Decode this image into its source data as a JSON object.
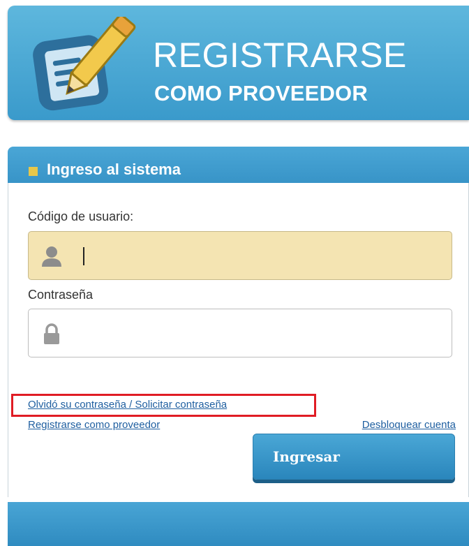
{
  "banner": {
    "title": "REGISTRARSE",
    "subtitle": "COMO PROVEEDOR",
    "icon": "document-pencil-icon"
  },
  "login": {
    "header_title": "Ingreso al sistema",
    "username_label": "Código de usuario:",
    "username_value": "",
    "username_icon": "user-icon",
    "password_label": "Contraseña",
    "password_value": "",
    "password_icon": "lock-icon",
    "forgot_link": "Olvidó su contraseña / Solicitar contraseña",
    "register_link": "Registrarse como proveedor",
    "unlock_link": "Desbloquear cuenta",
    "submit_label": "Ingresar"
  },
  "colors": {
    "brand_blue": "#3a9acb",
    "header_square": "#e7c74a",
    "active_input_bg": "#f4e4b2",
    "link": "#1f5fa0",
    "annotation_red": "#e01c24"
  }
}
